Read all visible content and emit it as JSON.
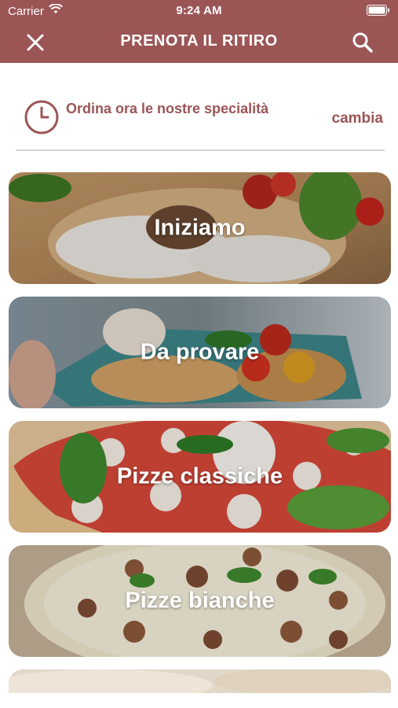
{
  "status_bar": {
    "carrier": "Carrier",
    "time": "9:24 AM"
  },
  "header": {
    "title": "PRENOTA IL RITIRO",
    "close_icon": "close-icon",
    "search_icon": "search-icon"
  },
  "order_info": {
    "text": "Ordina ora le nostre specialità",
    "change_label": "cambia",
    "icon": "clock-icon"
  },
  "categories": [
    {
      "label": "Iniziamo"
    },
    {
      "label": "Da provare"
    },
    {
      "label": "Pizze classiche"
    },
    {
      "label": "Pizze bianche"
    }
  ],
  "colors": {
    "accent": "#9b5555",
    "divider": "#d0d0d0",
    "background": "#ffffff"
  }
}
